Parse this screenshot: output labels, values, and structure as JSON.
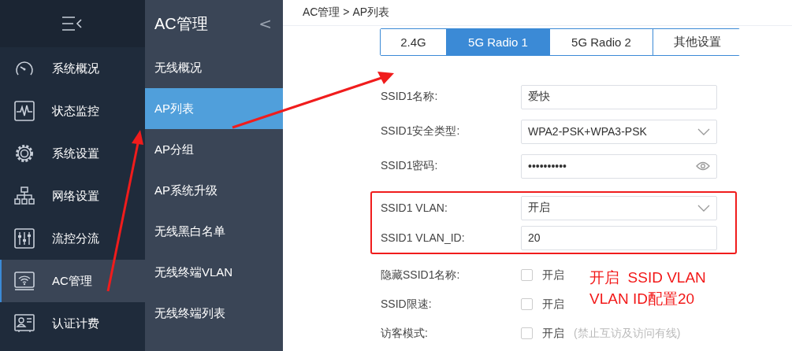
{
  "nav": {
    "items": [
      {
        "label": "系统概况",
        "selected": false
      },
      {
        "label": "状态监控",
        "selected": false
      },
      {
        "label": "系统设置",
        "selected": false
      },
      {
        "label": "网络设置",
        "selected": false
      },
      {
        "label": "流控分流",
        "selected": false
      },
      {
        "label": "AC管理",
        "selected": true
      },
      {
        "label": "认证计费",
        "selected": false
      }
    ]
  },
  "subnav": {
    "title": "AC管理",
    "collapse": "<",
    "items": [
      {
        "label": "无线概况",
        "selected": false
      },
      {
        "label": "AP列表",
        "selected": true
      },
      {
        "label": "AP分组",
        "selected": false
      },
      {
        "label": "AP系统升级",
        "selected": false
      },
      {
        "label": "无线黑白名单",
        "selected": false
      },
      {
        "label": "无线终端VLAN",
        "selected": false
      },
      {
        "label": "无线终端列表",
        "selected": false
      }
    ]
  },
  "breadcrumb": "AC管理 > AP列表",
  "tabs": [
    {
      "label": "2.4G",
      "selected": false
    },
    {
      "label": "5G Radio 1",
      "selected": true
    },
    {
      "label": "5G Radio 2",
      "selected": false
    },
    {
      "label": "其他设置",
      "selected": false
    }
  ],
  "form": {
    "sections": [
      {
        "highlighted": false,
        "rows": [
          {
            "kind": "text",
            "label": "SSID1名称:",
            "value": "爱快"
          },
          {
            "kind": "select",
            "label": "SSID1安全类型:",
            "value": "WPA2-PSK+WPA3-PSK"
          },
          {
            "kind": "password",
            "label": "SSID1密码:",
            "value": "••••••••••"
          }
        ]
      },
      {
        "highlighted": true,
        "rows": [
          {
            "kind": "select",
            "label": "SSID1 VLAN:",
            "value": "开启"
          },
          {
            "kind": "text",
            "label": "SSID1 VLAN_ID:",
            "value": "20"
          }
        ]
      },
      {
        "highlighted": false,
        "rows": [
          {
            "kind": "checkbox",
            "label": "隐藏SSID1名称:",
            "option": "开启",
            "checked": false
          },
          {
            "kind": "checkbox",
            "label": "SSID限速:",
            "option": "开启",
            "checked": false
          },
          {
            "kind": "checkbox",
            "label": "访客模式:",
            "option": "开启",
            "checked": false,
            "note": "(禁止互访及访问有线)"
          }
        ]
      }
    ]
  },
  "annotation": {
    "lines": [
      "开启  SSID VLAN",
      "VLAN ID配置20"
    ]
  }
}
